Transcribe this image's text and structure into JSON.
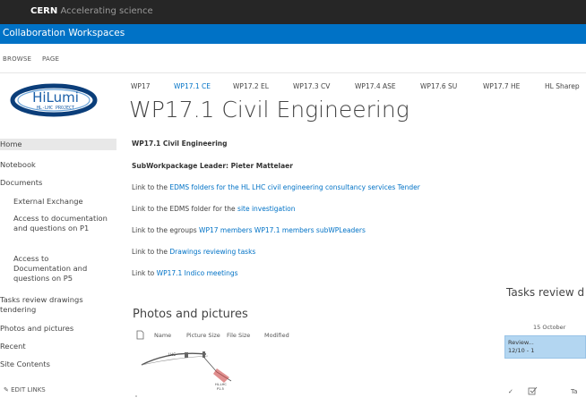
{
  "topbar": {
    "brand": "CERN",
    "tagline": "Accelerating science"
  },
  "suitebar": {
    "title": "Collaboration Workspaces"
  },
  "ribbon": {
    "browse": "BROWSE",
    "page": "PAGE"
  },
  "logo": {
    "text": "HiLumi",
    "subtext": "HL-LHC PROJECT"
  },
  "topnav": [
    "WP17",
    "WP17.1 CE",
    "WP17.2 EL",
    "WP17.3 CV",
    "WP17.4 ASE",
    "WP17.6 SU",
    "WP17.7 HE",
    "HL Sharep"
  ],
  "page_title": "WP17.1 Civil Engineering",
  "leftnav": {
    "home": "Home",
    "notebook": "Notebook",
    "documents": "Documents",
    "external_exchange": "External Exchange",
    "access_p1": "Access to documentation and questions on P1",
    "access_p5": "Access to Documentation and questions on P5",
    "tasks_review": "Tasks review drawings tendering",
    "photos": "Photos and pictures",
    "recent": "Recent",
    "site_contents": "Site Contents",
    "edit_links": "EDIT LINKS"
  },
  "content": {
    "heading": "WP17.1 Civil Engineering",
    "leader": "SubWorkpackage Leader: Pieter Mattelaer",
    "l1_prefix": "Link to the ",
    "l1_link": "EDMS folders for the HL LHC civil engineering consultancy services Tender",
    "l2_prefix": "Link to the EDMS folder for the ",
    "l2_link": "site investigation",
    "l3_prefix": "Link to the egroups ",
    "l3_link1": "WP17 members",
    "l3_link2": "WP17.1 members",
    "l3_link3": "subWPLeaders",
    "l4_prefix": "Link to the ",
    "l4_link": "Drawings reviewing tasks",
    "l5_prefix": "Link to ",
    "l5_link": "WP17.1 Indico meetings"
  },
  "photos": {
    "title": "Photos and pictures",
    "col_name": "Name",
    "col_picture_size": "Picture Size",
    "col_file_size": "File Size",
    "col_modified": "Modified",
    "thumb_label1": "LHC",
    "thumb_label2": "HL-LHC",
    "thumb_label3": "P1-5"
  },
  "tasks": {
    "title": "Tasks review d",
    "date": "15 October",
    "bar_line1": "Review...",
    "bar_line2": "12/10 - 1",
    "row_label": "Ta"
  }
}
